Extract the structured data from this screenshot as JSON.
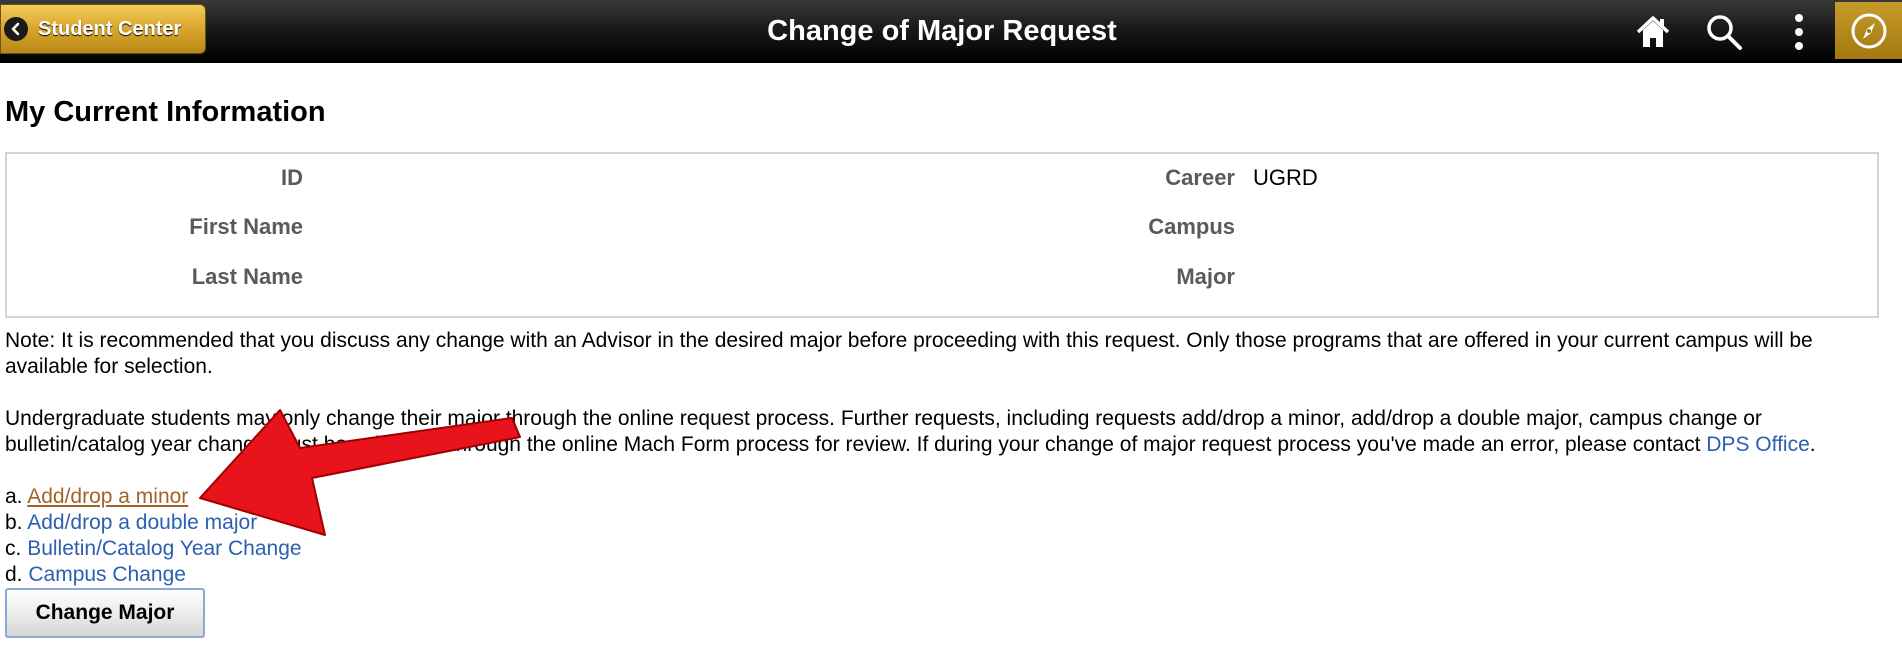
{
  "header": {
    "back_label": "Student Center",
    "title": "Change of Major Request",
    "icons": [
      "home-icon",
      "search-icon",
      "more-vertical-icon",
      "compass-icon"
    ]
  },
  "section": {
    "title": "My Current Information"
  },
  "info": {
    "id_label": "ID",
    "id_value": "",
    "first_name_label": "First Name",
    "first_name_value": "",
    "last_name_label": "Last Name",
    "last_name_value": "",
    "career_label": "Career",
    "career_value": "UGRD",
    "campus_label": "Campus",
    "campus_value": "",
    "major_label": "Major",
    "major_value": ""
  },
  "note": "Note: It is recommended that you discuss any change with an Advisor in the desired major before proceeding with this request. Only those programs that are offered in your current campus will be available for selection.",
  "paragraph": {
    "text": "Undergraduate students may only change their major through the online request process. Further requests, including requests add/drop a minor, add/drop a double major, campus change or bulletin/catalog year change must be submitted through the online Mach Form process for review. If during your change of major request process you've made an error, please contact",
    "link": "DPS Office",
    "end": "."
  },
  "options": [
    {
      "prefix": "a.",
      "label": "Add/drop a minor"
    },
    {
      "prefix": "b.",
      "label": "Add/drop a double major"
    },
    {
      "prefix": "c.",
      "label": "Bulletin/Catalog Year Change"
    },
    {
      "prefix": "d.",
      "label": "Campus Change"
    }
  ],
  "button": {
    "label": "Change Major"
  },
  "colors": {
    "header_bg": "#1a1a1a",
    "gold": "#d9a52c",
    "link": "#2c5fb0",
    "visited_link": "#a0642a",
    "arrow": "#e8131b"
  }
}
